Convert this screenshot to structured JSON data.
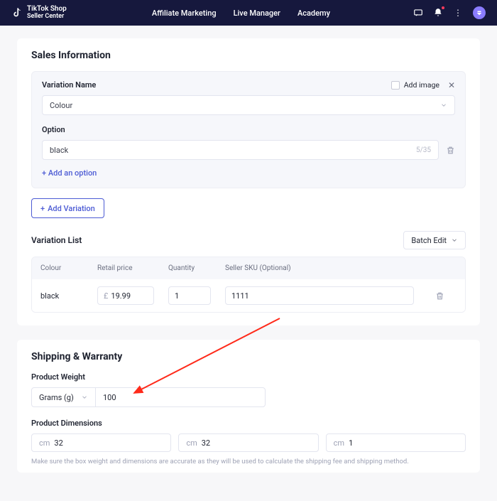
{
  "nav": {
    "brand_top": "TikTok Shop",
    "brand_bottom": "Seller Center",
    "links": [
      "Affiliate Marketing",
      "Live Manager",
      "Academy"
    ]
  },
  "sales": {
    "title": "Sales Information",
    "variation_name_label": "Variation Name",
    "add_image_label": "Add image",
    "colour_value": "Colour",
    "option_label": "Option",
    "option_value": "black",
    "option_counter": "5/35",
    "add_option": "+ Add an option",
    "add_variation": "Add Variation"
  },
  "vlist": {
    "title": "Variation List",
    "batch": "Batch Edit",
    "headers": [
      "Colour",
      "Retail price",
      "Quantity",
      "Seller SKU (Optional)"
    ],
    "row": {
      "colour": "black",
      "currency": "£",
      "price": "19.99",
      "qty": "1",
      "sku": "1111"
    }
  },
  "shipping": {
    "title": "Shipping & Warranty",
    "weight_label": "Product Weight",
    "unit": "Grams (g)",
    "weight_val": "100",
    "dims_label": "Product Dimensions",
    "dim_unit": "cm",
    "d1": "32",
    "d2": "32",
    "d3": "1",
    "hint": "Make sure the box weight and dimensions are accurate as they will be used to calculate the shipping fee and shipping method."
  }
}
